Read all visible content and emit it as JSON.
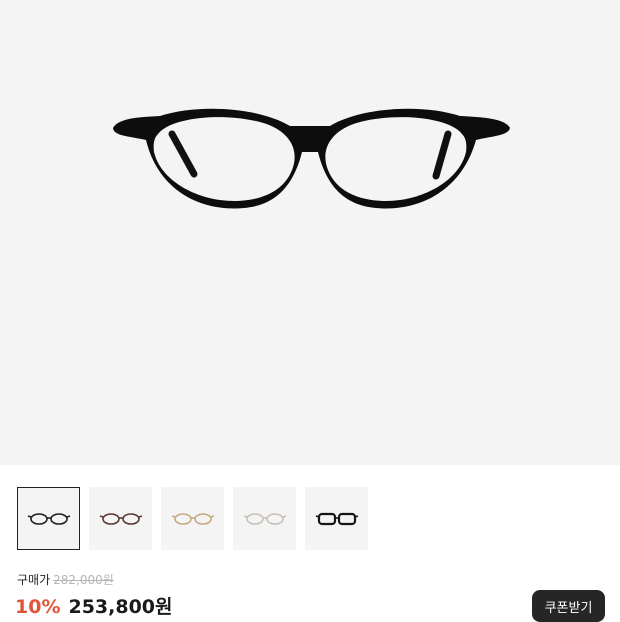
{
  "product": {
    "image_name": "oval-black-glasses"
  },
  "thumbnails": [
    {
      "name": "black-oval",
      "color": "#222222",
      "selected": true
    },
    {
      "name": "brown-oval",
      "color": "#5a3a34",
      "selected": false
    },
    {
      "name": "gold-oval",
      "color": "#c9ab82",
      "selected": false
    },
    {
      "name": "clear-oval",
      "color": "#c8c0b8",
      "selected": false
    },
    {
      "name": "black-square",
      "color": "#151515",
      "selected": false
    }
  ],
  "pricing": {
    "label": "구매가",
    "original_price": "282,000원",
    "discount": "10%",
    "sale_price": "253,800원"
  },
  "coupon_button": {
    "label": "쿠폰받기"
  },
  "colors": {
    "discount": "#e0553a",
    "button_bg": "#262626",
    "hero_bg": "#f4f4f4"
  }
}
